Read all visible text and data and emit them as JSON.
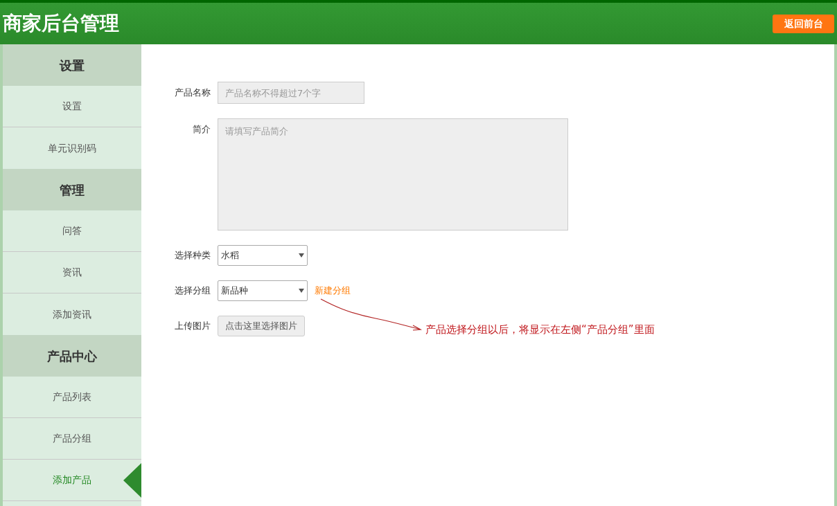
{
  "header": {
    "title": "商家后台管理",
    "back_button": "返回前台"
  },
  "sidebar": [
    {
      "heading": "设置",
      "items": [
        {
          "label": "设置",
          "selected": false
        },
        {
          "label": "单元识别码",
          "selected": false
        }
      ]
    },
    {
      "heading": "管理",
      "items": [
        {
          "label": "问答",
          "selected": false
        },
        {
          "label": "资讯",
          "selected": false
        },
        {
          "label": "添加资讯",
          "selected": false
        }
      ]
    },
    {
      "heading": "产品中心",
      "items": [
        {
          "label": "产品列表",
          "selected": false
        },
        {
          "label": "产品分组",
          "selected": false
        },
        {
          "label": "添加产品",
          "selected": true
        }
      ]
    }
  ],
  "form": [
    {
      "kind": "text",
      "label": "产品名称",
      "placeholder": "产品名称不得超过7个字"
    },
    {
      "kind": "textarea",
      "label": "简介",
      "placeholder": "请填写产品简介"
    },
    {
      "kind": "select",
      "label": "选择种类",
      "value": "水稻"
    },
    {
      "kind": "select",
      "label": "选择分组",
      "value": "新品种",
      "link": "新建分组"
    },
    {
      "kind": "upload",
      "label": "上传图片",
      "button": "点击这里选择图片"
    }
  ],
  "annotation": "产品选择分组以后，将显示在左侧“产品分组”里面"
}
